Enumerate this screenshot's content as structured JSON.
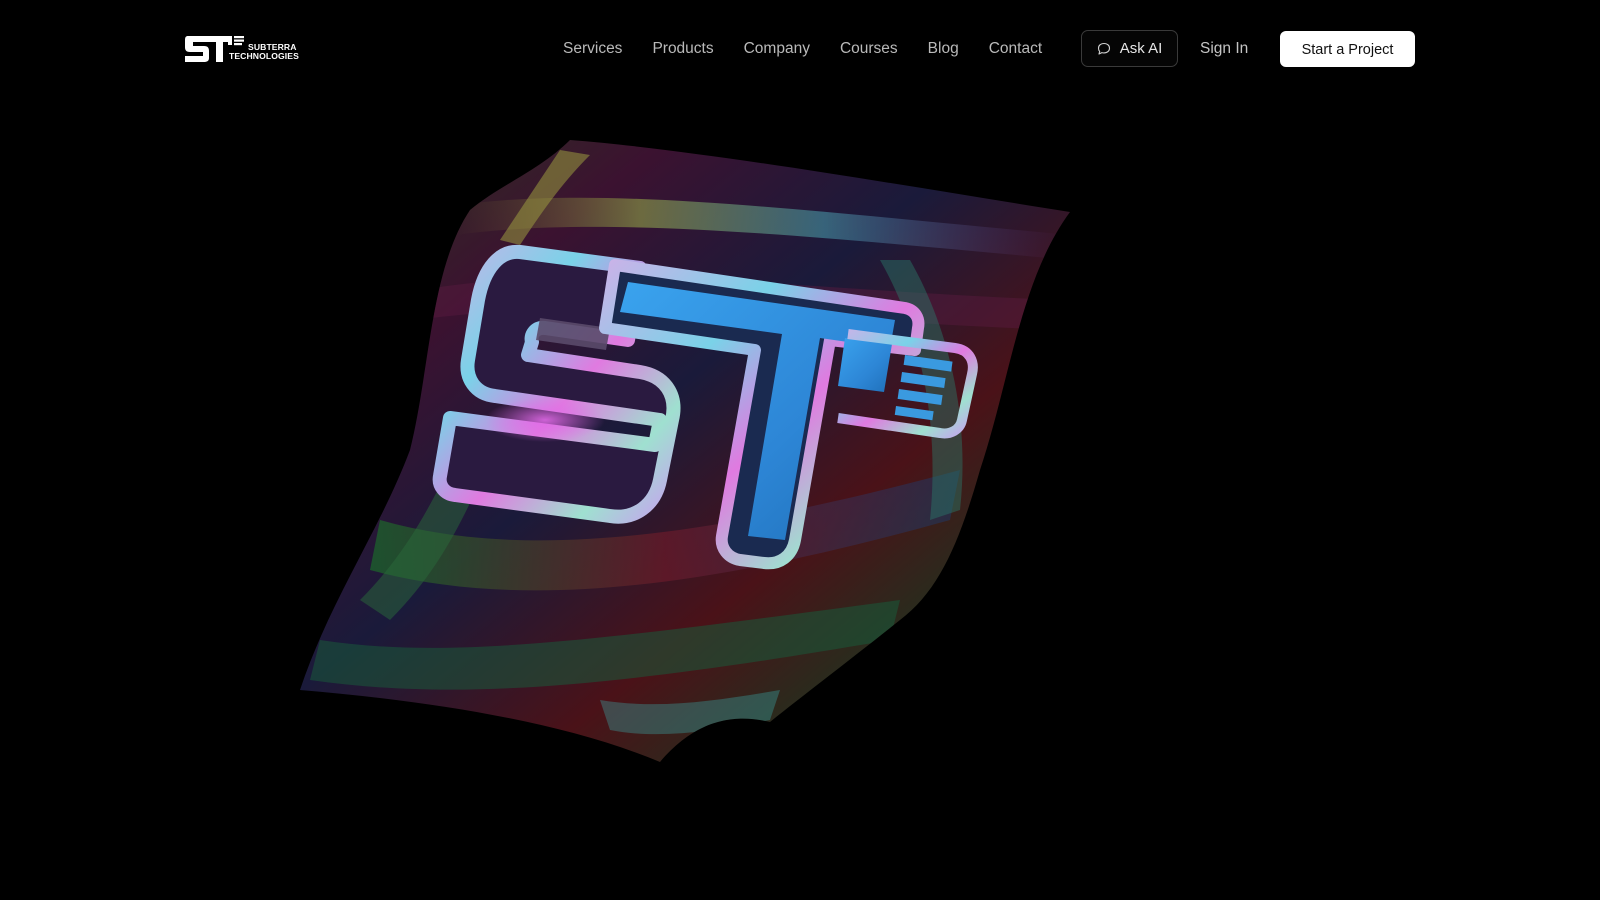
{
  "brand": {
    "name_line1": "SUBTERRA",
    "name_line2": "TECHNOLOGIES",
    "accent_blue": "#2e8fe0",
    "accent_magenta": "#d64ad8"
  },
  "nav": {
    "items": [
      {
        "label": "Services"
      },
      {
        "label": "Products"
      },
      {
        "label": "Company"
      },
      {
        "label": "Courses"
      },
      {
        "label": "Blog"
      },
      {
        "label": "Contact"
      }
    ],
    "ask_ai": {
      "label": "Ask AI",
      "icon": "chat-bubble-icon"
    },
    "sign_in": "Sign In",
    "cta": "Start a Project"
  },
  "hero": {
    "artwork": "iridescent-flag-logo"
  },
  "colors": {
    "background": "#000000",
    "nav_text": "#b9b9b9",
    "cta_bg": "#ffffff",
    "cta_text": "#111111"
  }
}
